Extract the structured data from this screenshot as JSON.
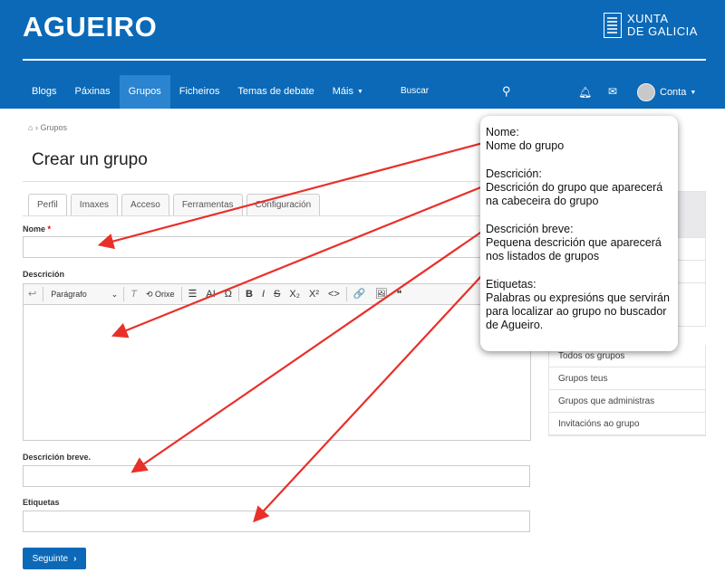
{
  "site": {
    "title": "AGUEIRO",
    "logo_line1": "XUNTA",
    "logo_line2": "DE GALICIA"
  },
  "nav": {
    "items": [
      {
        "label": "Blogs"
      },
      {
        "label": "Páxinas"
      },
      {
        "label": "Grupos"
      },
      {
        "label": "Ficheiros"
      },
      {
        "label": "Temas de debate"
      },
      {
        "label": "Máis"
      }
    ],
    "search_placeholder": "Buscar",
    "account_label": "Conta"
  },
  "breadcrumb": {
    "item": "Grupos"
  },
  "page": {
    "title": "Crear un grupo"
  },
  "tabs": [
    {
      "label": "Perfil"
    },
    {
      "label": "Imaxes"
    },
    {
      "label": "Acceso"
    },
    {
      "label": "Ferramentas"
    },
    {
      "label": "Configuración"
    }
  ],
  "form": {
    "name_label": "Nome",
    "required_mark": "*",
    "description_label": "Descrición",
    "brief_label": "Descrición breve.",
    "tags_label": "Etiquetas",
    "next_label": "Seguinte"
  },
  "editor": {
    "format_label": "Parágrafo",
    "source_label": "Orixe",
    "undo": "↩",
    "clear_format": "T",
    "font_size": "AI",
    "special_char": "Ω",
    "bold": "B",
    "italic": "I",
    "strike": "S",
    "subscript": "X₂",
    "superscript": "X²",
    "code": "<>",
    "link": "🔗",
    "image": "🖼",
    "quote": "❝"
  },
  "sidebar": {
    "links": [
      {
        "label": "Todos os grupos"
      },
      {
        "label": "Grupos teus"
      },
      {
        "label": "Grupos que administras"
      },
      {
        "label": "Invitacións ao grupo"
      }
    ]
  },
  "callout": {
    "entries": [
      {
        "title": "Nome:",
        "text": "Nome do grupo"
      },
      {
        "title": "Descrición:",
        "text": "Descrición do grupo que aparecerá na cabeceira do grupo"
      },
      {
        "title": "Descrición breve:",
        "text": "Pequena descrición que aparecerá nos listados de grupos"
      },
      {
        "title": "Etiquetas:",
        "text": "Palabras ou expresións que servirán para localizar ao grupo no buscador de Agueiro."
      }
    ]
  },
  "colors": {
    "brand": "#0b69b7",
    "nav_active": "#2a84cf",
    "arrow": "#e8302a"
  }
}
